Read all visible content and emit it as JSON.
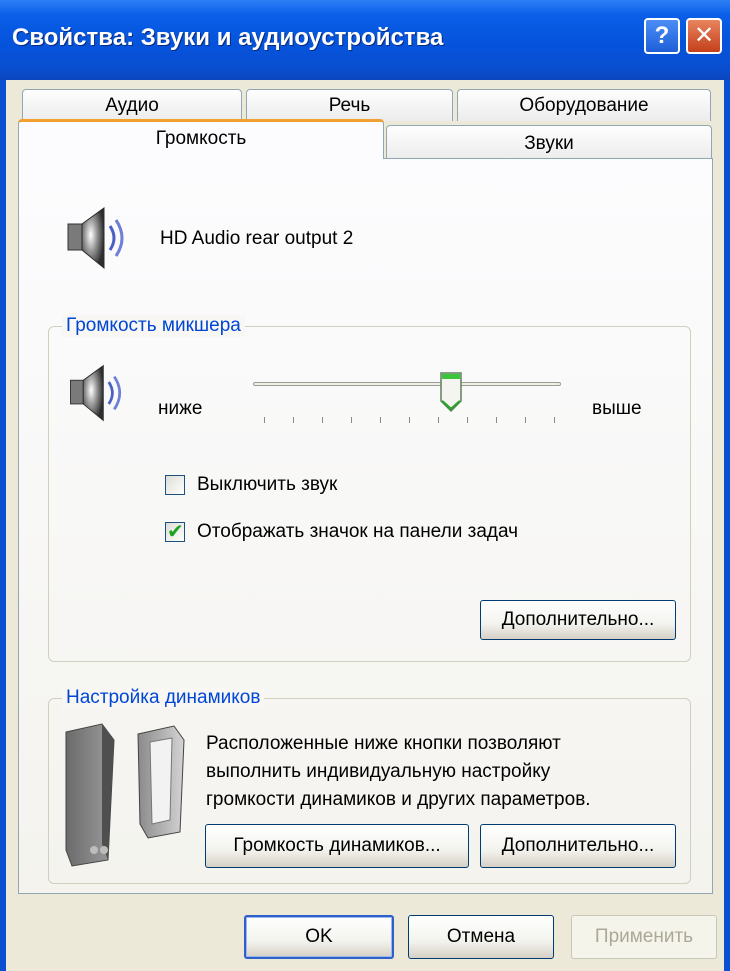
{
  "window": {
    "title": "Свойства: Звуки и аудиоустройства",
    "help_label": "?",
    "close_label": "✕"
  },
  "tabs": {
    "row1": [
      "Аудио",
      "Речь",
      "Оборудование"
    ],
    "row2": [
      "Громкость",
      "Звуки"
    ],
    "active": "Громкость"
  },
  "device": {
    "name": "HD Audio rear output 2"
  },
  "mixer": {
    "group_title": "Громкость микшера",
    "low_label": "ниже",
    "high_label": "выше",
    "volume_fraction": 0.645,
    "mute_label": "Выключить звук",
    "mute_checked": false,
    "tray_icon_label": "Отображать значок на панели задач",
    "tray_icon_checked": true,
    "advanced_button": "Дополнительно..."
  },
  "speakers": {
    "group_title": "Настройка динамиков",
    "description_lines": [
      "Расположенные ниже кнопки позволяют",
      "выполнить индивидуальную настройку",
      "громкости динамиков и других параметров."
    ],
    "volume_button": "Громкость динамиков...",
    "advanced_button": "Дополнительно..."
  },
  "footer": {
    "ok": "OK",
    "cancel": "Отмена",
    "apply": "Применить"
  }
}
